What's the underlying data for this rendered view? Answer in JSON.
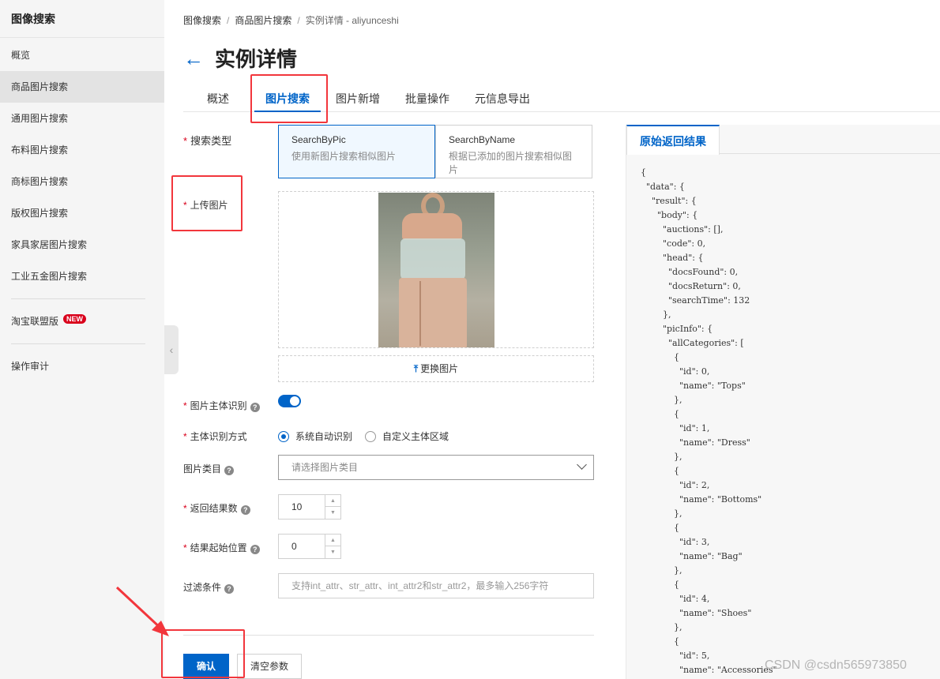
{
  "sidebar": {
    "title": "图像搜索",
    "items": [
      {
        "label": "概览"
      },
      {
        "label": "商品图片搜索",
        "active": true
      },
      {
        "label": "通用图片搜索"
      },
      {
        "label": "布料图片搜索"
      },
      {
        "label": "商标图片搜索"
      },
      {
        "label": "版权图片搜索"
      },
      {
        "label": "家具家居图片搜索"
      },
      {
        "label": "工业五金图片搜索"
      }
    ],
    "taobao": {
      "label": "淘宝联盟版",
      "badge": "NEW"
    },
    "audit": {
      "label": "操作审计"
    },
    "collapse_icon": "‹"
  },
  "breadcrumb": {
    "items": [
      "图像搜索",
      "商品图片搜索",
      "实例详情 - aliyunceshi"
    ],
    "separator": "/"
  },
  "page": {
    "title": "实例详情",
    "back_icon": "←"
  },
  "tabs": [
    {
      "label": "概述"
    },
    {
      "label": "图片搜索",
      "active": true
    },
    {
      "label": "图片新增"
    },
    {
      "label": "批量操作"
    },
    {
      "label": "元信息导出"
    }
  ],
  "form": {
    "search_type": {
      "label": "搜索类型",
      "options": [
        {
          "title": "SearchByPic",
          "desc": "使用新图片搜索相似图片",
          "selected": true
        },
        {
          "title": "SearchByName",
          "desc": "根据已添加的图片搜索相似图片",
          "selected": false
        }
      ]
    },
    "upload": {
      "label": "上传图片",
      "change_label": "更换图片",
      "change_icon": "⤒"
    },
    "subject_recognition": {
      "label": "图片主体识别",
      "enabled": true
    },
    "recognition_mode": {
      "label": "主体识别方式",
      "options": [
        {
          "label": "系统自动识别",
          "checked": true
        },
        {
          "label": "自定义主体区域",
          "checked": false
        }
      ]
    },
    "category": {
      "label": "图片类目",
      "placeholder": "请选择图片类目"
    },
    "result_count": {
      "label": "返回结果数",
      "value": "10"
    },
    "start_position": {
      "label": "结果起始位置",
      "value": "0"
    },
    "filter": {
      "label": "过滤条件",
      "placeholder": "支持int_attr、str_attr、int_attr2和str_attr2，最多输入256字符"
    },
    "help_icon": "?",
    "confirm_label": "确认",
    "clear_label": "清空参数"
  },
  "result": {
    "tab_label": "原始返回结果",
    "json_text": "{\n  \"data\": {\n    \"result\": {\n      \"body\": {\n        \"auctions\": [],\n        \"code\": 0,\n        \"head\": {\n          \"docsFound\": 0,\n          \"docsReturn\": 0,\n          \"searchTime\": 132\n        },\n        \"picInfo\": {\n          \"allCategories\": [\n            {\n              \"id\": 0,\n              \"name\": \"Tops\"\n            },\n            {\n              \"id\": 1,\n              \"name\": \"Dress\"\n            },\n            {\n              \"id\": 2,\n              \"name\": \"Bottoms\"\n            },\n            {\n              \"id\": 3,\n              \"name\": \"Bag\"\n            },\n            {\n              \"id\": 4,\n              \"name\": \"Shoes\"\n            },\n            {\n              \"id\": 5,\n              \"name\": \"Accessories\""
  },
  "watermark": "CSDN @csdn565973850",
  "colors": {
    "accent": "#0064c8",
    "annotation": "#f2363c",
    "required": "#d9001b"
  }
}
